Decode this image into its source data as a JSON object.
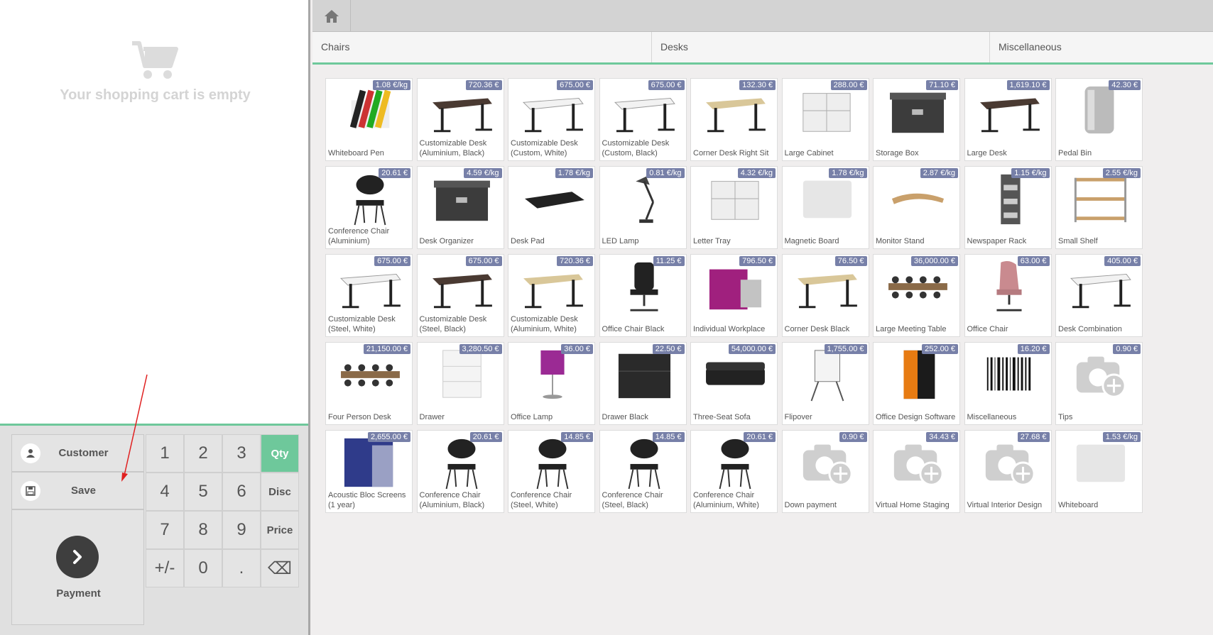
{
  "cart": {
    "empty_text": "Your shopping cart is empty"
  },
  "actionpad": {
    "customer_label": "Customer",
    "save_label": "Save",
    "payment_label": "Payment"
  },
  "numpad": [
    "1",
    "2",
    "3",
    "Qty",
    "4",
    "5",
    "6",
    "Disc",
    "7",
    "8",
    "9",
    "Price",
    "+/-",
    "0",
    ".",
    "⌫"
  ],
  "categories": [
    "Chairs",
    "Desks",
    "Miscellaneous"
  ],
  "colors": {
    "accent": "#6ec89b",
    "price_badge": "#7780a8"
  },
  "products": [
    {
      "name": "Whiteboard Pen",
      "price": "1.08 €/kg",
      "icon": "pens"
    },
    {
      "name": "Customizable Desk (Aluminium, Black)",
      "price": "720.36 €",
      "icon": "desk-dark"
    },
    {
      "name": "Customizable Desk (Custom, White)",
      "price": "675.00 €",
      "icon": "desk-white"
    },
    {
      "name": "Customizable Desk (Custom, Black)",
      "price": "675.00 €",
      "icon": "desk-white"
    },
    {
      "name": "Corner Desk Right Sit",
      "price": "132.30 €",
      "icon": "desk-wood"
    },
    {
      "name": "Large Cabinet",
      "price": "288.00 €",
      "icon": "cabinet"
    },
    {
      "name": "Storage Box",
      "price": "71.10 €",
      "icon": "box"
    },
    {
      "name": "Large Desk",
      "price": "1,619.10 €",
      "icon": "desk-dark"
    },
    {
      "name": "Pedal Bin",
      "price": "42.30 €",
      "icon": "bin"
    },
    {
      "name": "Conference Chair (Aluminium)",
      "price": "20.61 €",
      "icon": "chair"
    },
    {
      "name": "Desk Organizer",
      "price": "4.59 €/kg",
      "icon": "box"
    },
    {
      "name": "Desk Pad",
      "price": "1.78 €/kg",
      "icon": "pad"
    },
    {
      "name": "LED Lamp",
      "price": "0.81 €/kg",
      "icon": "lamp"
    },
    {
      "name": "Letter Tray",
      "price": "4.32 €/kg",
      "icon": "cabinet"
    },
    {
      "name": "Magnetic Board",
      "price": "1.78 €/kg",
      "icon": "board"
    },
    {
      "name": "Monitor Stand",
      "price": "2.87 €/kg",
      "icon": "stand"
    },
    {
      "name": "Newspaper Rack",
      "price": "1.15 €/kg",
      "icon": "rack"
    },
    {
      "name": "Small Shelf",
      "price": "2.55 €/kg",
      "icon": "shelf"
    },
    {
      "name": "Customizable Desk (Steel, White)",
      "price": "675.00 €",
      "icon": "desk-white"
    },
    {
      "name": "Customizable Desk (Steel, Black)",
      "price": "675.00 €",
      "icon": "desk-dark"
    },
    {
      "name": "Customizable Desk (Aluminium, White)",
      "price": "720.36 €",
      "icon": "desk-wood"
    },
    {
      "name": "Office Chair Black",
      "price": "11.25 €",
      "icon": "office-chair"
    },
    {
      "name": "Individual Workplace",
      "price": "796.50 €",
      "icon": "workplace"
    },
    {
      "name": "Corner Desk Black",
      "price": "76.50 €",
      "icon": "desk-wood"
    },
    {
      "name": "Large Meeting Table",
      "price": "36,000.00 €",
      "icon": "meeting"
    },
    {
      "name": "Office Chair",
      "price": "63.00 €",
      "icon": "pink-chair"
    },
    {
      "name": "Desk Combination",
      "price": "405.00 €",
      "icon": "desk-white"
    },
    {
      "name": "Four Person Desk",
      "price": "21,150.00 €",
      "icon": "meeting"
    },
    {
      "name": "Drawer",
      "price": "3,280.50 €",
      "icon": "drawer"
    },
    {
      "name": "Office Lamp",
      "price": "36.00 €",
      "icon": "lamp-purple"
    },
    {
      "name": "Drawer Black",
      "price": "22.50 €",
      "icon": "drawer-black"
    },
    {
      "name": "Three-Seat Sofa",
      "price": "54,000.00 €",
      "icon": "sofa"
    },
    {
      "name": "Flipover",
      "price": "1,755.00 €",
      "icon": "flipover"
    },
    {
      "name": "Office Design Software",
      "price": "252.00 €",
      "icon": "software"
    },
    {
      "name": "Miscellaneous",
      "price": "16.20 €",
      "icon": "barcode"
    },
    {
      "name": "Tips",
      "price": "0.90 €",
      "icon": "camera"
    },
    {
      "name": "Acoustic Bloc Screens (1 year)",
      "price": "2,655.00 €",
      "icon": "screen"
    },
    {
      "name": "Conference Chair (Aluminium, Black)",
      "price": "20.61 €",
      "icon": "chair"
    },
    {
      "name": "Conference Chair (Steel, White)",
      "price": "14.85 €",
      "icon": "chair"
    },
    {
      "name": "Conference Chair (Steel, Black)",
      "price": "14.85 €",
      "icon": "chair"
    },
    {
      "name": "Conference Chair (Aluminium, White)",
      "price": "20.61 €",
      "icon": "chair"
    },
    {
      "name": "Down payment",
      "price": "0.90 €",
      "icon": "camera"
    },
    {
      "name": "Virtual Home Staging",
      "price": "34.43 €",
      "icon": "camera"
    },
    {
      "name": "Virtual Interior Design",
      "price": "27.68 €",
      "icon": "camera"
    },
    {
      "name": "Whiteboard",
      "price": "1.53 €/kg",
      "icon": "board"
    }
  ]
}
